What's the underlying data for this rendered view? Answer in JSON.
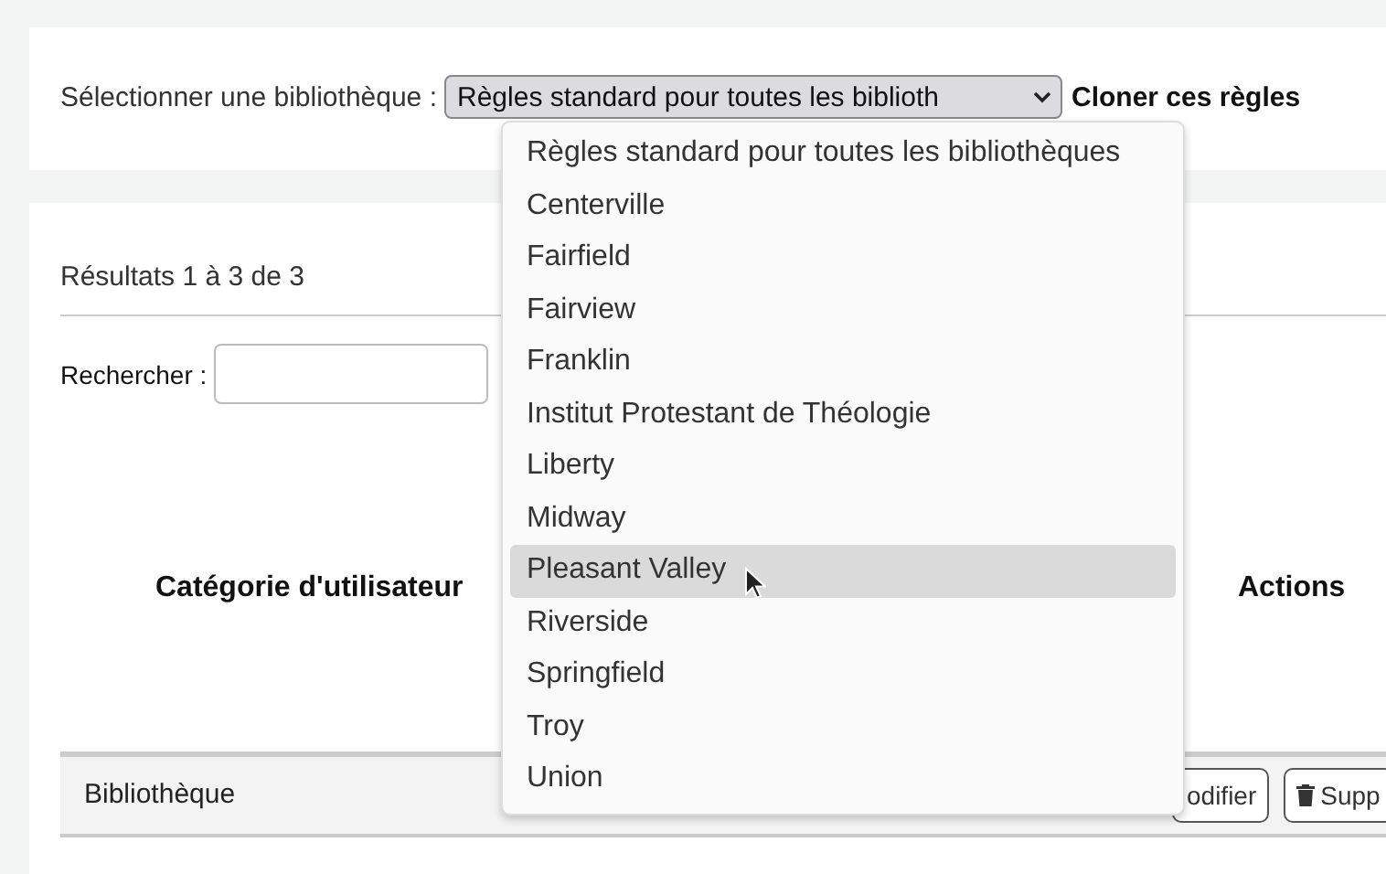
{
  "library_selector": {
    "label": "Sélectionner une bibliothèque :",
    "value": "Règles standard pour toutes les biblioth",
    "clone_label": "Cloner ces règles"
  },
  "dropdown": {
    "options": [
      {
        "label": "Règles standard pour toutes les bibliothèques",
        "selected": false
      },
      {
        "label": "Centerville",
        "selected": false
      },
      {
        "label": "Fairfield",
        "selected": false
      },
      {
        "label": "Fairview",
        "selected": false
      },
      {
        "label": "Franklin",
        "selected": false
      },
      {
        "label": "Institut Protestant de Théologie",
        "selected": false
      },
      {
        "label": "Liberty",
        "selected": false
      },
      {
        "label": "Midway",
        "selected": false
      },
      {
        "label": "Pleasant Valley",
        "selected": true
      },
      {
        "label": "Riverside",
        "selected": false
      },
      {
        "label": "Springfield",
        "selected": false
      },
      {
        "label": "Troy",
        "selected": false
      },
      {
        "label": "Union",
        "selected": false
      }
    ]
  },
  "results": {
    "summary": "Résultats 1 à 3 de 3",
    "search_label": "Rechercher :"
  },
  "table": {
    "columns": [
      "Catégorie d'utilisateur",
      "Actions"
    ],
    "rows": [
      {
        "kind": "group",
        "cell": "Bibliothèque",
        "buttons": [
          "odifier",
          "Supp"
        ]
      }
    ]
  }
}
